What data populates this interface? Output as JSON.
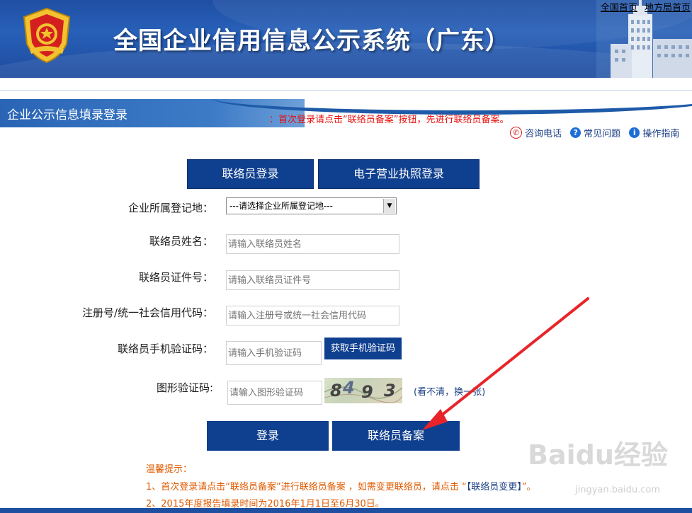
{
  "header": {
    "title": "全国企业信用信息公示系统（广东）",
    "links": [
      "全国首页",
      "地方局首页"
    ]
  },
  "section": {
    "title": "企业公示信息填录登录",
    "notice": "：首次登录请点击“联络员备案”按钮，先进行联络员备案。"
  },
  "help": {
    "phone": "咨询电话",
    "faq": "常见问题",
    "guide": "操作指南"
  },
  "tabs": [
    "联络员登录",
    "电子营业执照登录"
  ],
  "form": {
    "region_label": "企业所属登记地：",
    "region_value": "---请选择企业所属登记地---",
    "name_label": "联络员姓名：",
    "name_placeholder": "请输入联络员姓名",
    "id_label": "联络员证件号：",
    "id_placeholder": "请输入联络员证件号",
    "reg_label": "注册号/统一社会信用代码：",
    "reg_placeholder": "请输入注册号或统一社会信用代码",
    "sms_label": "联络员手机验证码：",
    "sms_placeholder": "请输入手机验证码",
    "sms_button": "获取手机验证码",
    "captcha_label": "图形验证码:",
    "captcha_placeholder": "请输入图形验证码",
    "captcha_text": [
      "8",
      "4",
      "9",
      "3"
    ],
    "captcha_refresh": "(看不清，换一张)"
  },
  "buttons": {
    "login": "登录",
    "register": "联络员备案"
  },
  "tips": {
    "heading": "温馨提示：",
    "tip1_a": "1、首次登录请点击“联络员备案”进行联络员备案 ，如需变更联络员，请点击 “",
    "tip1_link": "【联络员变更】",
    "tip1_b": "”。",
    "tip2": "2、2015年度报告填录时间为2016年1月1日至6月30日。"
  },
  "watermark": {
    "text": "Baidu经验",
    "sub": "jingyan.baidu.com"
  },
  "colors": {
    "header_blue": "#1f4fa3",
    "button_blue": "#0f3f8f",
    "notice_red": "#e8100f",
    "tip_orange": "#e05a00",
    "arrow_red": "#e8242a"
  }
}
